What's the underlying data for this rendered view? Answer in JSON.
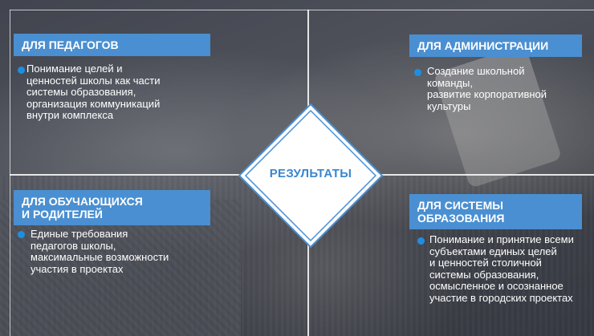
{
  "center": {
    "label": "РЕЗУЛЬТАТЫ"
  },
  "quadrants": {
    "teachers": {
      "title": "ДЛЯ ПЕДАГОГОВ",
      "text": [
        "Понимание целей и",
        "ценностей школы как части",
        "системы образования,",
        "организация коммуникаций",
        "внутри комплекса"
      ]
    },
    "administration": {
      "title": "ДЛЯ АДМИНИСТРАЦИИ",
      "text": [
        "Создание школьной",
        "команды,",
        "развитие корпоративной",
        "культуры"
      ]
    },
    "students": {
      "title_lines": [
        "ДЛЯ ОБУЧАЮЩИХСЯ",
        "И РОДИТЕЛЕЙ"
      ],
      "text": [
        "Единые требования",
        "педагогов школы,",
        "максимальные возможности",
        "участия в проектах"
      ]
    },
    "education_system": {
      "title_lines": [
        "ДЛЯ СИСТЕМЫ",
        "ОБРАЗОВАНИЯ"
      ],
      "text": [
        "Понимание и принятие всеми",
        "субъектами единых целей",
        "и ценностей столичной",
        "системы образования,",
        "осмысленное и осознанное",
        "участие в городских проектах"
      ]
    }
  },
  "colors": {
    "header_bg": "#4a8fd1",
    "accent": "#1e8fe0",
    "center_text": "#3a86cf"
  }
}
